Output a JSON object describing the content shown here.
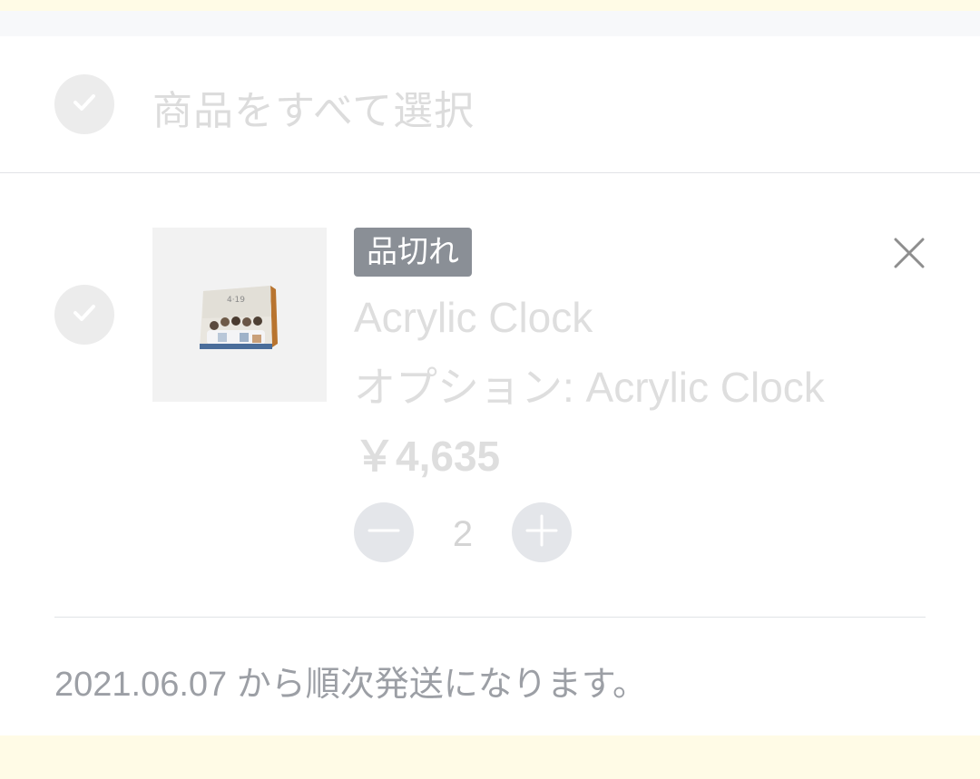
{
  "cart": {
    "select_all_label": "商品をすべて選択",
    "item": {
      "badge": "品切れ",
      "name": "Acrylic Clock",
      "option": "オプション: Acrylic Clock",
      "price": "￥4,635",
      "quantity": "2",
      "shipping_note": "2021.06.07 から順次発送になります。"
    }
  },
  "icons": {
    "select_all": "check-icon",
    "item_select": "check-icon",
    "remove": "close-icon",
    "decrement": "minus-icon",
    "increment": "plus-icon"
  },
  "colors": {
    "banner_bg": "#fffbe6",
    "badge_bg": "#8a8f96",
    "check_circle": "#ececec",
    "qty_button": "#e4e6ea",
    "disabled_text": "#dedede",
    "note_text": "#9c9fa5"
  }
}
